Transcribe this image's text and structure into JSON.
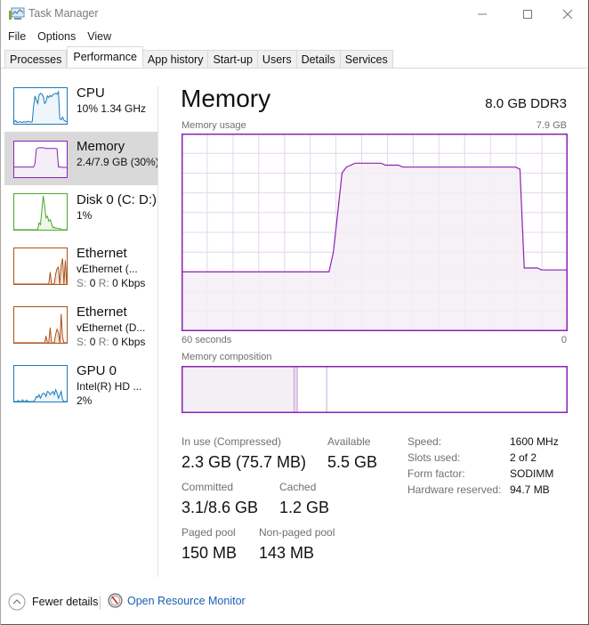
{
  "window": {
    "title": "Task Manager",
    "icon": "task-manager-icon",
    "controls": {
      "minimize": "minimize-icon",
      "maximize": "maximize-icon",
      "close": "close-icon"
    }
  },
  "menu": [
    "File",
    "Options",
    "View"
  ],
  "tabs": [
    {
      "label": "Processes",
      "active": false
    },
    {
      "label": "Performance",
      "active": true
    },
    {
      "label": "App history",
      "active": false
    },
    {
      "label": "Start-up",
      "active": false
    },
    {
      "label": "Users",
      "active": false
    },
    {
      "label": "Details",
      "active": false
    },
    {
      "label": "Services",
      "active": false
    }
  ],
  "sidebar": [
    {
      "title": "CPU",
      "sub1": "10% 1.34 GHz",
      "color": "#1a7bb9",
      "fill": "#eef5fb",
      "selected": false,
      "series": [
        0.05,
        0.1,
        0.04,
        0.05,
        0.06,
        0.05,
        0.04,
        0.06,
        0.05,
        0.05,
        0.07,
        0.06,
        0.05,
        0.06,
        0.5,
        0.82,
        0.7,
        0.6,
        0.85,
        0.9,
        0.88,
        0.8,
        0.6,
        0.65,
        0.82,
        0.78,
        0.84,
        0.8,
        0.86,
        0.88,
        0.9,
        0.87,
        0.95,
        0.15,
        0.12,
        0.2,
        0.1,
        0.08,
        0.06
      ]
    },
    {
      "title": "Memory",
      "sub1": "2.4/7.9 GB (30%)",
      "color": "#8b22b4",
      "fill": "#f4eef7",
      "selected": true,
      "series": [
        0.3,
        0.3,
        0.3,
        0.3,
        0.3,
        0.3,
        0.3,
        0.3,
        0.3,
        0.3,
        0.3,
        0.3,
        0.3,
        0.3,
        0.3,
        0.4,
        0.82,
        0.86,
        0.87,
        0.87,
        0.87,
        0.87,
        0.86,
        0.85,
        0.85,
        0.85,
        0.85,
        0.85,
        0.85,
        0.85,
        0.85,
        0.84,
        0.3,
        0.3,
        0.3,
        0.29,
        0.29,
        0.29,
        0.29
      ]
    },
    {
      "title": "Disk 0 (C: D:)",
      "sub1": "1%",
      "color": "#4ea72e",
      "fill": "#eef7e9",
      "selected": false,
      "series": [
        0,
        0,
        0,
        0,
        0,
        0,
        0,
        0,
        0,
        0,
        0,
        0,
        0,
        0,
        0,
        0,
        0,
        0,
        0.2,
        0.15,
        0.6,
        1.0,
        0.7,
        0.35,
        0.4,
        0.25,
        0.3,
        0.18,
        0.05,
        0.08,
        0.04,
        0.05,
        0.03,
        0.04,
        0,
        0,
        0,
        0,
        0
      ]
    },
    {
      "title": "Ethernet",
      "sub1": "vEthernet (...",
      "send_label": "S:",
      "send_val": "0",
      "recv_label": "R:",
      "recv_val": "0 Kbps",
      "color": "#a7521b",
      "fill": "#f6e6da",
      "selected": false,
      "series": [
        0,
        0,
        0,
        0,
        0,
        0,
        0,
        0,
        0,
        0,
        0,
        0,
        0,
        0,
        0,
        0,
        0,
        0,
        0,
        0,
        0,
        0,
        0,
        0,
        0,
        0,
        0.35,
        0,
        0,
        0,
        0.3,
        0.45,
        0.5,
        0,
        0.55,
        0.75,
        0,
        0.7,
        0
      ]
    },
    {
      "title": "Ethernet",
      "sub1": "vEthernet (D...",
      "send_label": "S:",
      "send_val": "0",
      "recv_label": "R:",
      "recv_val": "0 Kbps",
      "color": "#a7521b",
      "fill": "#f6e6da",
      "selected": false,
      "series": [
        0,
        0,
        0,
        0,
        0,
        0,
        0,
        0,
        0,
        0,
        0,
        0,
        0,
        0,
        0,
        0,
        0,
        0,
        0,
        0,
        0,
        0,
        0,
        0.2,
        0,
        0,
        0.45,
        0,
        0,
        0,
        0.25,
        0.4,
        0.3,
        0,
        0.85,
        0.15,
        0,
        0,
        0
      ]
    },
    {
      "title": "GPU 0",
      "sub1": "Intel(R) HD ...",
      "sub2": "2%",
      "color": "#1a7bb9",
      "fill": "#eef5fb",
      "selected": false,
      "series": [
        0,
        0,
        0,
        0.03,
        0,
        0,
        0.05,
        0,
        0,
        0.04,
        0,
        0,
        0,
        0,
        0,
        0.05,
        0.15,
        0.12,
        0.2,
        0.1,
        0.2,
        0.25,
        0.22,
        0.15,
        0.3,
        0.28,
        0.2,
        0.25,
        0.3,
        0.2,
        0.35,
        0.25,
        0.1,
        0.2,
        0.3,
        0.05,
        0,
        0,
        0
      ]
    }
  ],
  "main": {
    "title": "Memory",
    "spec": "8.0 GB DDR3",
    "usage_label": "Memory usage",
    "usage_max": "7.9 GB",
    "time_start": "60 seconds",
    "time_end": "0",
    "composition_label": "Memory composition",
    "accent": "#8b22b4",
    "fill": "#f3eff5",
    "grid": "#e6d4ec",
    "usage_series": [
      0.3,
      0.3,
      0.3,
      0.3,
      0.3,
      0.3,
      0.3,
      0.3,
      0.3,
      0.3,
      0.3,
      0.3,
      0.3,
      0.3,
      0.3,
      0.3,
      0.3,
      0.3,
      0.3,
      0.3,
      0.3,
      0.3,
      0.3,
      0.3,
      0.3,
      0.3,
      0.3,
      0.3,
      0.3,
      0.3,
      0.3,
      0.3,
      0.3,
      0.3,
      0.3,
      0.4,
      0.6,
      0.8,
      0.83,
      0.84,
      0.85,
      0.85,
      0.85,
      0.85,
      0.85,
      0.85,
      0.85,
      0.84,
      0.84,
      0.84,
      0.84,
      0.83,
      0.83,
      0.83,
      0.83,
      0.83,
      0.83,
      0.83,
      0.83,
      0.83,
      0.83,
      0.83,
      0.83,
      0.83,
      0.83,
      0.83,
      0.83,
      0.83,
      0.83,
      0.83,
      0.83,
      0.83,
      0.83,
      0.83,
      0.83,
      0.83,
      0.83,
      0.83,
      0.82,
      0.32,
      0.32,
      0.32,
      0.32,
      0.31,
      0.31,
      0.31,
      0.31,
      0.31,
      0.31,
      0.31
    ],
    "composition": {
      "in_use_gb": 2.3,
      "modified_gb": 0.07,
      "standby_gb": 1.2,
      "total_gb": 7.9
    }
  },
  "stats": {
    "in_use_label": "In use (Compressed)",
    "in_use_value": "2.3 GB (75.7 MB)",
    "available_label": "Available",
    "available_value": "5.5 GB",
    "committed_label": "Committed",
    "committed_value": "3.1/8.6 GB",
    "cached_label": "Cached",
    "cached_value": "1.2 GB",
    "paged_label": "Paged pool",
    "paged_value": "150 MB",
    "nonpaged_label": "Non-paged pool",
    "nonpaged_value": "143 MB"
  },
  "specs": [
    {
      "label": "Speed:",
      "value": "1600 MHz"
    },
    {
      "label": "Slots used:",
      "value": "2 of 2"
    },
    {
      "label": "Form factor:",
      "value": "SODIMM"
    },
    {
      "label": "Hardware reserved:",
      "value": "94.7 MB"
    }
  ],
  "footer": {
    "fewer_details": "Fewer details",
    "open_resource_monitor": "Open Resource Monitor"
  }
}
